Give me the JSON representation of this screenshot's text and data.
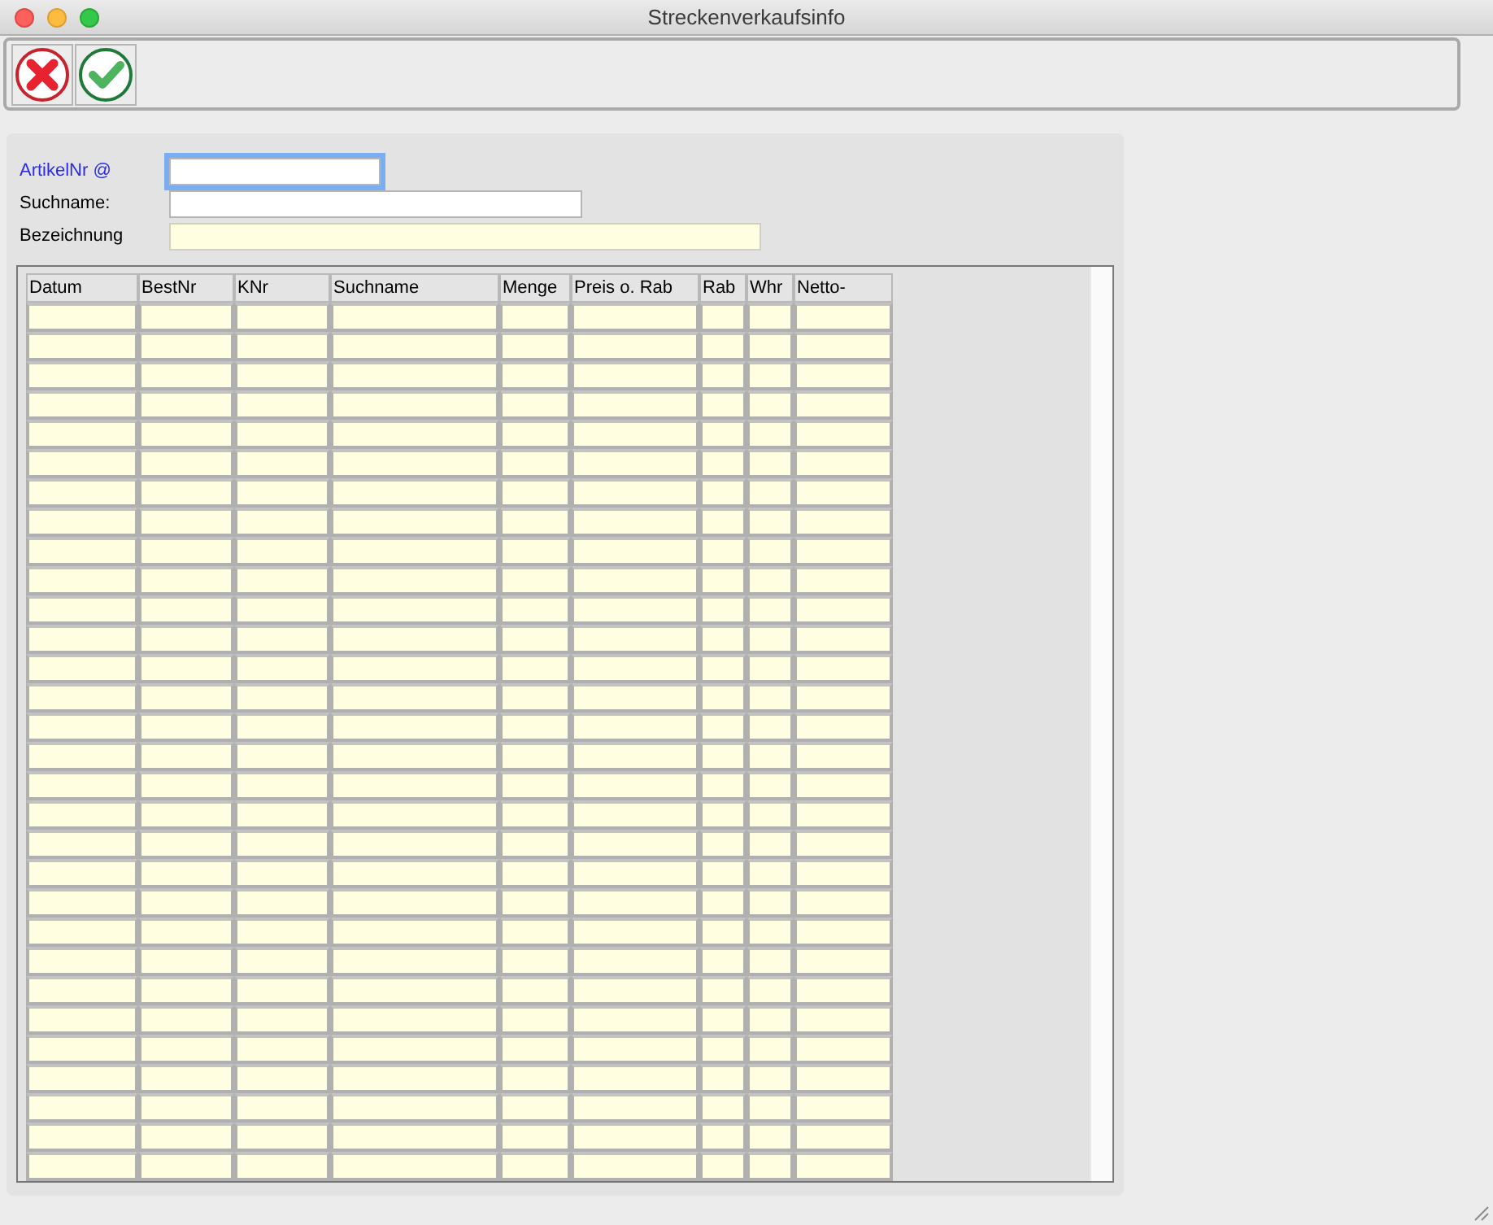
{
  "window": {
    "title": "Streckenverkaufsinfo"
  },
  "toolbar": [
    {
      "kind": "cancel"
    },
    {
      "kind": "confirm"
    }
  ],
  "fields": [
    {
      "label": "ArtikelNr @",
      "kind": "key",
      "focused": true
    },
    {
      "label": "Suchname:",
      "kind": "edit",
      "focused": false
    },
    {
      "label": "Bezeichnung",
      "kind": "readonly",
      "focused": false
    }
  ],
  "table": {
    "columns": [
      "Datum",
      "BestNr",
      "KNr",
      "Suchname",
      "Menge",
      "Preis o. Rab",
      "Rab",
      "Whr",
      "Netto-"
    ]
  }
}
